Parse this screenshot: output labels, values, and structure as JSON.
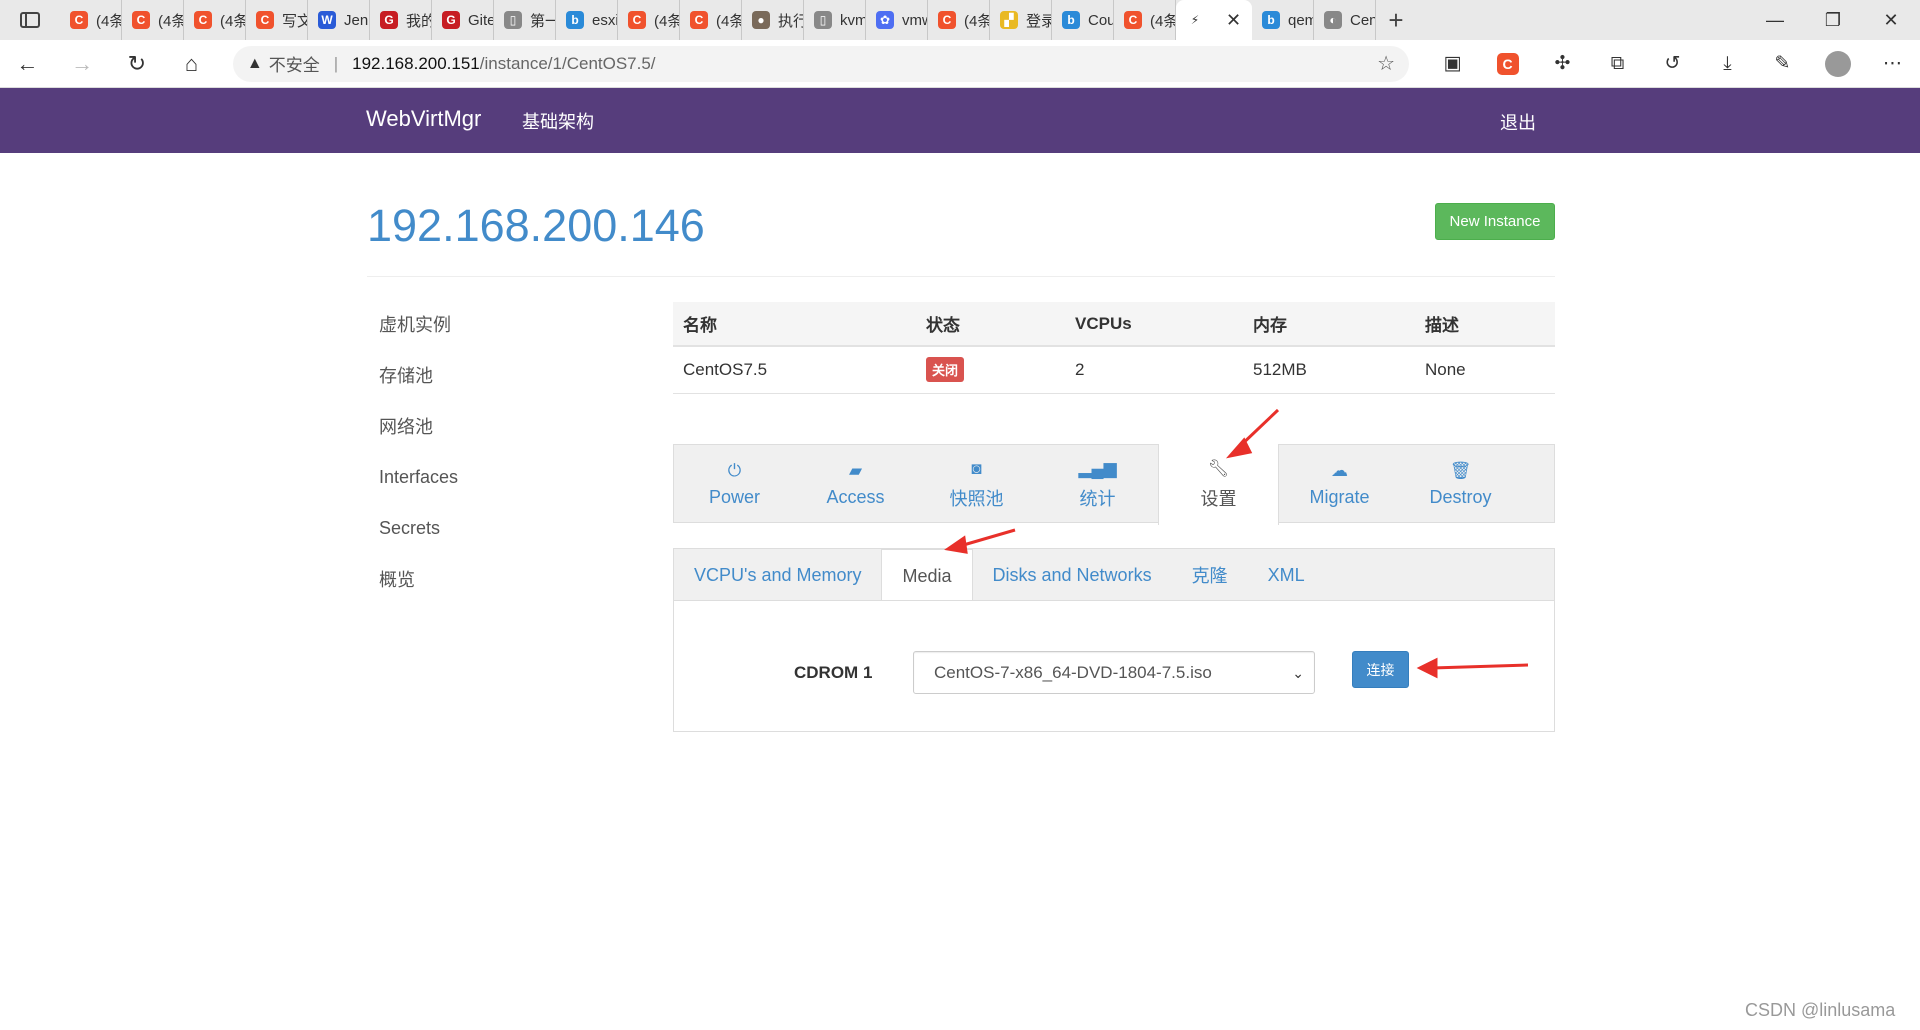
{
  "browser": {
    "tabs": [
      {
        "label": "(4条",
        "favicon": "csdn-icon",
        "color": "#f0522d",
        "glyph": "C"
      },
      {
        "label": "(4条",
        "favicon": "csdn-icon",
        "color": "#f0522d",
        "glyph": "C"
      },
      {
        "label": "(4条",
        "favicon": "csdn-icon",
        "color": "#f0522d",
        "glyph": "C"
      },
      {
        "label": "写文",
        "favicon": "csdn-icon",
        "color": "#f0522d",
        "glyph": "C"
      },
      {
        "label": "Jenk",
        "favicon": "w-icon",
        "color": "#2a5bd7",
        "glyph": "W"
      },
      {
        "label": "我的",
        "favicon": "gitee-icon",
        "color": "#c71d23",
        "glyph": "G"
      },
      {
        "label": "Gite",
        "favicon": "gitee-icon",
        "color": "#c71d23",
        "glyph": "G"
      },
      {
        "label": "第一",
        "favicon": "page-icon",
        "color": "#888888",
        "glyph": "▯"
      },
      {
        "label": "esxi",
        "favicon": "bing-icon",
        "color": "#2a8ad8",
        "glyph": "b"
      },
      {
        "label": "(4条",
        "favicon": "csdn-icon",
        "color": "#f0522d",
        "glyph": "C"
      },
      {
        "label": "(4条",
        "favicon": "csdn-icon",
        "color": "#f0522d",
        "glyph": "C"
      },
      {
        "label": "执行",
        "favicon": "avatar-icon",
        "color": "#7a6a5a",
        "glyph": "●"
      },
      {
        "label": "kvm",
        "favicon": "page-icon",
        "color": "#888888",
        "glyph": "▯"
      },
      {
        "label": "vmw",
        "favicon": "baidu-icon",
        "color": "#4e6ef2",
        "glyph": "✿"
      },
      {
        "label": "(4条",
        "favicon": "csdn-icon",
        "color": "#f0522d",
        "glyph": "C"
      },
      {
        "label": "登录",
        "favicon": "python-icon",
        "color": "#e9b923",
        "glyph": "▞"
      },
      {
        "label": "Cou",
        "favicon": "bing-icon",
        "color": "#2a8ad8",
        "glyph": "b"
      },
      {
        "label": "(4条",
        "favicon": "csdn-icon",
        "color": "#f0522d",
        "glyph": "C"
      },
      {
        "label": "",
        "favicon": "active-tab-icon",
        "color": "#ffffff",
        "glyph": "⚡",
        "active": true
      },
      {
        "label": "qem",
        "favicon": "bing-icon",
        "color": "#2a8ad8",
        "glyph": "b"
      },
      {
        "label": "Cen",
        "favicon": "github-icon",
        "color": "#888888",
        "glyph": "◐"
      }
    ],
    "url": {
      "warning_icon": "warning-icon",
      "insecure_label": "不安全",
      "host": "192.168.200.151",
      "path": "/instance/1/CentOS7.5/"
    }
  },
  "app": {
    "brand": "WebVirtMgr",
    "nav_infrastructure": "基础架构",
    "nav_logout": "退出"
  },
  "header": {
    "title": "192.168.200.146",
    "new_instance_label": "New Instance"
  },
  "sidebar": {
    "items": [
      {
        "label": "虚机实例",
        "active": true
      },
      {
        "label": "存储池"
      },
      {
        "label": "网络池"
      },
      {
        "label": "Interfaces"
      },
      {
        "label": "Secrets"
      },
      {
        "label": "概览"
      }
    ]
  },
  "instance_table": {
    "headers": [
      "名称",
      "状态",
      "VCPUs",
      "内存",
      "描述"
    ],
    "row": {
      "name": "CentOS7.5",
      "status": "关闭",
      "vcpus": "2",
      "memory": "512MB",
      "description": "None"
    },
    "status_color": "#d9534f"
  },
  "action_tabs": [
    {
      "label": "Power",
      "icon": "power-icon"
    },
    {
      "label": "Access",
      "icon": "briefcase-icon"
    },
    {
      "label": "快照池",
      "icon": "camera-icon"
    },
    {
      "label": "统计",
      "icon": "signal-icon"
    },
    {
      "label": "设置",
      "icon": "wrench-icon",
      "active": true
    },
    {
      "label": "Migrate",
      "icon": "cloud-upload-icon"
    },
    {
      "label": "Destroy",
      "icon": "trash-icon"
    }
  ],
  "settings_tabs": [
    {
      "label": "VCPU's and Memory"
    },
    {
      "label": "Media",
      "active": true
    },
    {
      "label": "Disks and Networks"
    },
    {
      "label": "克隆"
    },
    {
      "label": "XML"
    }
  ],
  "media": {
    "cdrom_label": "CDROM 1",
    "selected_iso": "CentOS-7-x86_64-DVD-1804-7.5.iso",
    "connect_label": "连接"
  },
  "watermark": "CSDN @linlusama",
  "colors": {
    "navbar": "#563d7c",
    "primary": "#428bca",
    "success": "#5cb85c",
    "danger": "#d9534f",
    "annotation_arrow": "#e8302a"
  }
}
